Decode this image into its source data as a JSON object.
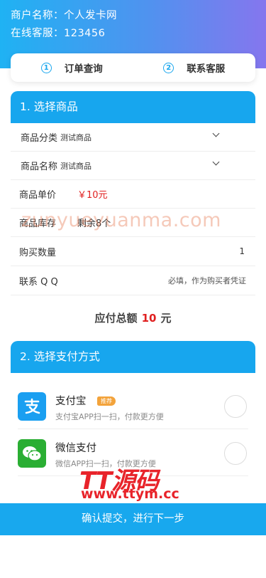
{
  "header": {
    "merchant_label": "商户名称：",
    "merchant_name": "个人发卡网",
    "service_label": "在线客服：",
    "service_value": "123456"
  },
  "quick_nav": [
    {
      "num": "①",
      "label": "订单查询"
    },
    {
      "num": "②",
      "label": "联系客服"
    }
  ],
  "section1": {
    "title": "1. 选择商品",
    "category": {
      "label": "商品分类",
      "value": "测试商品"
    },
    "product": {
      "label": "商品名称",
      "value": "测试商品"
    },
    "price": {
      "label": "商品单价",
      "value": "￥10元"
    },
    "stock": {
      "label": "商品库存",
      "value": "剩余8个"
    },
    "quantity": {
      "label": "购买数量",
      "value": "1"
    },
    "qq": {
      "label": "联系 Q Q",
      "placeholder": "必填，作为购买者凭证"
    }
  },
  "total": {
    "label": "应付总额",
    "amount": "10",
    "unit": "元"
  },
  "section2": {
    "title": "2. 选择支付方式",
    "methods": [
      {
        "name": "支付宝",
        "badge": "推荐",
        "desc": "支付宝APP扫一扫，付款更方便",
        "icon": "alipay-icon",
        "color": "#1a9ff1"
      },
      {
        "name": "微信支付",
        "desc": "微信APP扫一扫，付款更方便",
        "icon": "wechat-icon",
        "color": "#2aae33"
      }
    ]
  },
  "submit": {
    "label": "确认提交，进行下一步"
  },
  "watermarks": {
    "url": "zunyueyuanma.com",
    "logo": "TT源码",
    "site": "www.ttym.cc"
  },
  "colors": {
    "accent": "#17a6ee",
    "price": "#e02020",
    "badge": "#f3a33b"
  }
}
